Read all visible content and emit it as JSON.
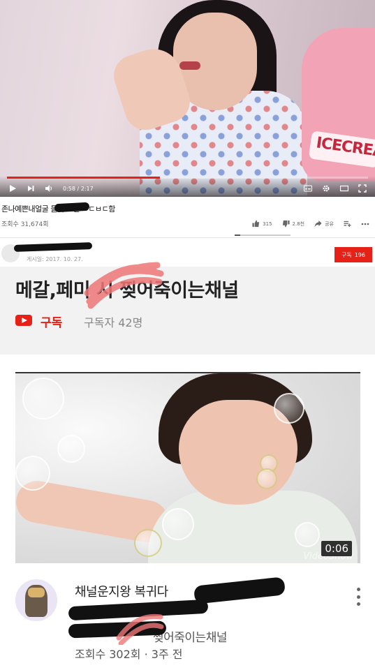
{
  "player": {
    "current_time": "0:58",
    "duration": "2:17",
    "progress_fraction": 0.423,
    "bag_text": "ICECREA",
    "accent_color": "#e62117"
  },
  "video1": {
    "title": "존나예쁜내얼굴    들이 보면 ㅂㄷㅂㄷ함",
    "views": "조회수 31,674회",
    "likes": "315",
    "dislikes": "2.8천",
    "share_label": "공유",
    "like_ratio": 0.1
  },
  "channel": {
    "post_date": "게시일: 2017. 10. 27.",
    "subscribe_label": "구독",
    "subscribe_count": "196"
  },
  "banner": {
    "title": "메갈,페미    시 찢어죽이는채널",
    "subscribe_label": "구독",
    "subscriber_count": "구독자 42명"
  },
  "video2": {
    "duration": "0:06",
    "watermark": "VideoShow",
    "title": "채널운지왕 복귀다",
    "subtitle": "찢어죽이는채널",
    "views": "조회수 302회 · 3주 전"
  },
  "icons": [
    "play-icon",
    "next-icon",
    "volume-icon",
    "subtitles-icon",
    "settings-icon",
    "theater-icon",
    "fullscreen-icon",
    "like-icon",
    "dislike-icon",
    "share-icon",
    "add-to-icon",
    "more-icon",
    "youtube-logo-icon"
  ]
}
